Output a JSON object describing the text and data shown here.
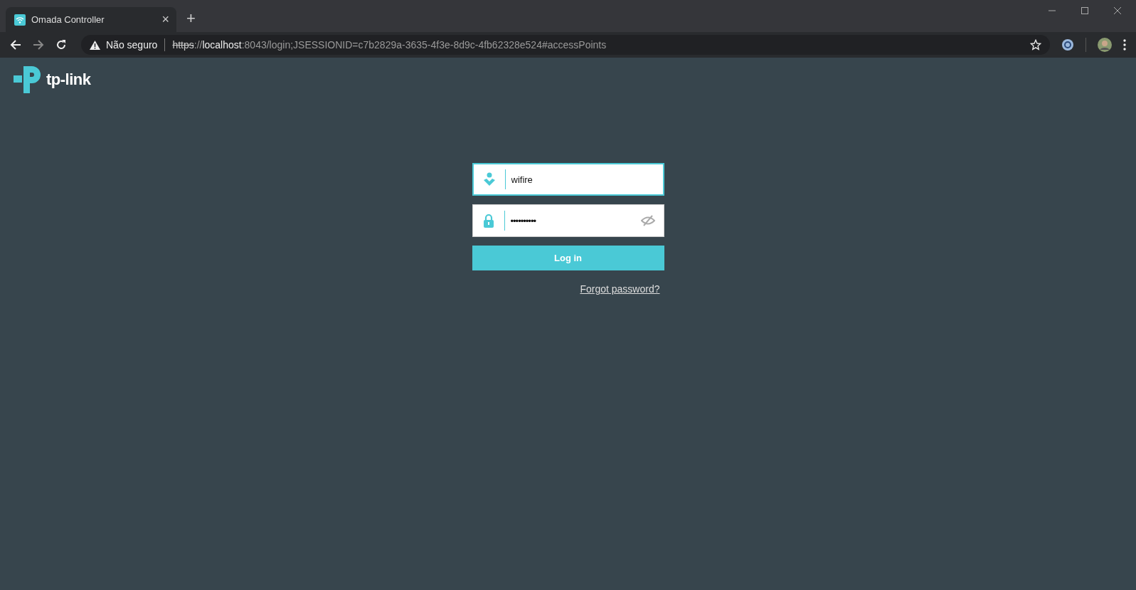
{
  "browser": {
    "tab": {
      "title": "Omada Controller",
      "close": "×"
    },
    "new_tab": "+",
    "security": "Não seguro",
    "url": [
      {
        "kind": "scheme",
        "text": "https"
      },
      {
        "kind": "muted",
        "text": "://"
      },
      {
        "kind": "host",
        "text": "localhost"
      },
      {
        "kind": "muted",
        "text": ":8043/login;JSESSIONID=c7b2829a-3635-4f3e-8d9c-4fb62328e524#accessPoints"
      }
    ]
  },
  "logo": {
    "text": "tp-link"
  },
  "login": {
    "username": {
      "value": "wifire",
      "focused": true
    },
    "password": {
      "value": "••••••••••",
      "focused": false
    },
    "button": "Log in",
    "forgot": "Forgot password?"
  }
}
